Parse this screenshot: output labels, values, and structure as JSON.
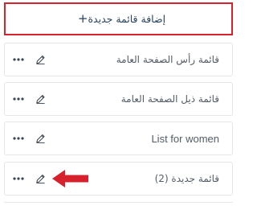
{
  "add_menu": {
    "label": "إضافة قائمة جديدة",
    "icon": "plus-icon",
    "plus_glyph": "+"
  },
  "menus": [
    {
      "title": "قائمة رأس الصفحة العامة",
      "icons": [
        "edit-icon",
        "more-icon"
      ]
    },
    {
      "title": "قائمة ذيل الصفحة العامة",
      "icons": [
        "edit-icon",
        "more-icon"
      ]
    },
    {
      "title": "List for women",
      "icons": [
        "edit-icon",
        "more-icon"
      ]
    },
    {
      "title": "قائمة جديدة (2)",
      "icons": [
        "edit-icon",
        "more-icon"
      ]
    }
  ],
  "annotation": {
    "icon": "red-arrow-pointing-left"
  },
  "colors": {
    "accent_border": "#d7222e",
    "text": "#27425e",
    "row_text": "#525c66",
    "row_border": "#e4e7ea",
    "arrow": "#d7222e"
  }
}
